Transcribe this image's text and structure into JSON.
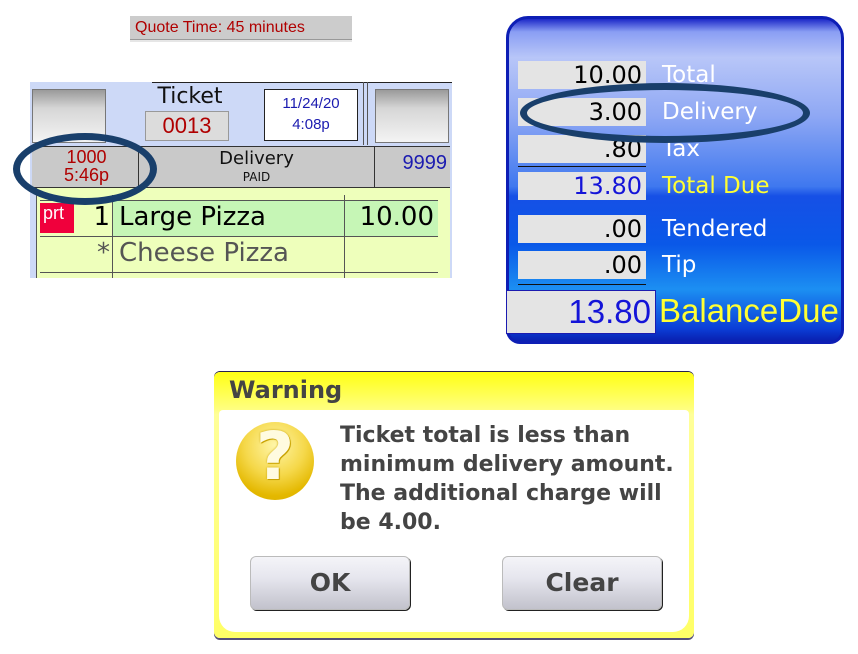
{
  "quote": {
    "text": "Quote Time:  45 minutes"
  },
  "ticket": {
    "label": "Ticket",
    "number": "0013",
    "date": "11/24/20",
    "time": "4:08p",
    "order_id": "1000",
    "order_time": "5:46p",
    "order_type": "Delivery",
    "payment_status": "PAID",
    "customer_number": "9999",
    "items": [
      {
        "tag": "prt",
        "qty": "1",
        "name": "Large Pizza",
        "price": "10.00"
      },
      {
        "tag": "",
        "qty": "*",
        "name": "Cheese Pizza",
        "price": ""
      }
    ]
  },
  "balance": {
    "rows": [
      {
        "value": "10.00",
        "label": "Total"
      },
      {
        "value": "3.00",
        "label": "Delivery"
      },
      {
        "value": ".80",
        "label": "Tax"
      },
      {
        "value": "13.80",
        "label": "Total Due"
      },
      {
        "value": ".00",
        "label": "Tendered"
      },
      {
        "value": ".00",
        "label": "Tip"
      }
    ],
    "balance_due_value": "13.80",
    "balance_due_label": "BalanceDue"
  },
  "dialog": {
    "title": "Warning",
    "icon": "question-icon",
    "icon_glyph": "?",
    "message": "Ticket total is less than minimum delivery amount. The additional charge will be 4.00.",
    "buttons": {
      "ok": "OK",
      "clear": "Clear"
    }
  },
  "colors": {
    "accent_red": "#b00000",
    "accent_blue": "#1b1bb0",
    "highlight_oval": "#193f6b",
    "dialog_yellow": "#ffff33",
    "balance_label_yellow": "#ffff33"
  }
}
